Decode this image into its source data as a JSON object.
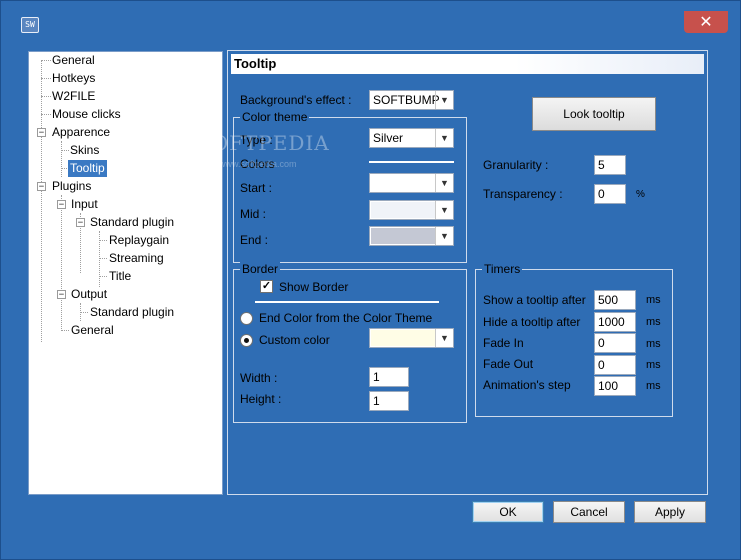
{
  "window": {
    "icon_text": "SW",
    "close_glyph": "✕"
  },
  "tree": {
    "items": [
      {
        "label": "General"
      },
      {
        "label": "Hotkeys"
      },
      {
        "label": "W2FILE"
      },
      {
        "label": "Mouse clicks"
      },
      {
        "label": "Apparence",
        "expander": "−"
      },
      {
        "label": "Skins"
      },
      {
        "label": "Tooltip",
        "selected": true
      },
      {
        "label": "Plugins",
        "expander": "−"
      },
      {
        "label": "Input",
        "expander": "−"
      },
      {
        "label": "Standard plugin",
        "expander": "−"
      },
      {
        "label": "Replaygain"
      },
      {
        "label": "Streaming"
      },
      {
        "label": "Title"
      },
      {
        "label": "Output",
        "expander": "−"
      },
      {
        "label": "Standard plugin"
      },
      {
        "label": "General"
      }
    ]
  },
  "panel": {
    "title": "Tooltip",
    "background_effect_label": "Background's effect :",
    "background_effect_value": "SOFTBUMP",
    "color_theme": {
      "title": "Color theme",
      "type_label": "Type :",
      "type_value": "Silver",
      "colors_label": "Colors",
      "start_label": "Start :",
      "mid_label": "Mid :",
      "end_label": "End :",
      "start_color": "#ffffff",
      "mid_color": "#f0f3f8",
      "end_color": "#c4c8d4"
    },
    "look_tooltip_button": "Look tooltip",
    "granularity_label": "Granularity :",
    "granularity_value": "5",
    "transparency_label": "Transparency :",
    "transparency_value": "0",
    "transparency_unit": "%",
    "border": {
      "title": "Border",
      "show_border_label": "Show Border",
      "show_border_checked": true,
      "end_color_label": "End Color from the Color Theme",
      "custom_color_label": "Custom color",
      "custom_color": "#fffde6",
      "width_label": "Width :",
      "width_value": "1",
      "height_label": "Height :",
      "height_value": "1"
    },
    "timers": {
      "title": "Timers",
      "rows": [
        {
          "label": "Show a tooltip after",
          "value": "500",
          "unit": "ms"
        },
        {
          "label": "Hide a tooltip after",
          "value": "1000",
          "unit": "ms"
        },
        {
          "label": "Fade In",
          "value": "0",
          "unit": "ms"
        },
        {
          "label": "Fade Out",
          "value": "0",
          "unit": "ms"
        },
        {
          "label": "Animation's step",
          "value": "100",
          "unit": "ms"
        }
      ]
    }
  },
  "buttons": {
    "ok": "OK",
    "cancel": "Cancel",
    "apply": "Apply"
  },
  "watermark": {
    "text": "SOFTPEDIA",
    "sub": "www.softpedia.com"
  },
  "colors": {
    "window_bg": "#2f6db4",
    "selection": "#3a79c3"
  }
}
